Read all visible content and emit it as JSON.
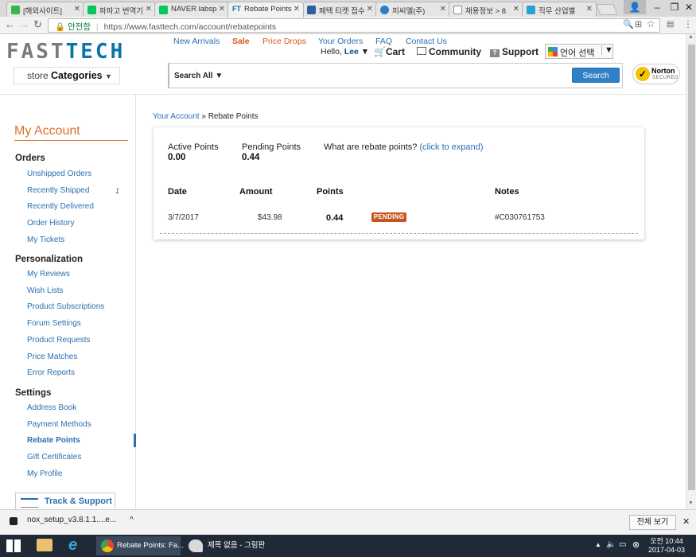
{
  "browser": {
    "tabs": [
      {
        "label": "[해외사이트]",
        "color": "#3bb54a"
      },
      {
        "label": "파파고 번역기",
        "color": "#03c75a"
      },
      {
        "label": "NAVER labsp",
        "color": "#03c75a"
      },
      {
        "label": "Rebate Points",
        "color": "#0b74a8"
      },
      {
        "label": "페텍 티켓 접수",
        "color": "#2f5d9e"
      },
      {
        "label": "피씨엘(주)",
        "color": "#2a7fc6"
      },
      {
        "label": "채용정보 > 8",
        "color": "#888888"
      },
      {
        "label": "직무 산업별",
        "color": "#2a9fd6"
      }
    ],
    "secure_label": "안전함",
    "url": "https://www.fasttech.com/account/rebatepoints"
  },
  "header": {
    "logo_part1": "FAST",
    "logo_part2": "TECH",
    "top_links": [
      "New Arrivals",
      "Sale",
      "Price Drops",
      "Your Orders",
      "FAQ",
      "Contact Us"
    ],
    "hello_prefix": "Hello,",
    "hello_name": "Lee",
    "cart": "Cart",
    "community": "Community",
    "support": "Support",
    "language": "언어 선택",
    "store_prefix": "store",
    "categories": "Categories",
    "search_scope": "Search All",
    "search_button": "Search",
    "norton_line1": "Norton",
    "norton_line2": "SECURED"
  },
  "sidebar": {
    "title": "My Account",
    "orders_title": "Orders",
    "orders": [
      "Unshipped Orders",
      "Recently Shipped",
      "Recently Delivered",
      "Order History",
      "My Tickets"
    ],
    "recently_shipped_count": "1",
    "personalization_title": "Personalization",
    "personalization": [
      "My Reviews",
      "Wish Lists",
      "Product Subscriptions",
      "Forum Settings",
      "Product Requests",
      "Price Matches",
      "Error Reports"
    ],
    "settings_title": "Settings",
    "settings": [
      "Address Book",
      "Payment Methods",
      "Rebate Points",
      "Gift Certificates",
      "My Profile"
    ],
    "track_support": "Track & Support"
  },
  "main": {
    "breadcrumb_link": "Your Account",
    "breadcrumb_sep": "»",
    "breadcrumb_current": "Rebate Points",
    "active_points_label": "Active Points",
    "active_points_value": "0.00",
    "pending_points_label": "Pending Points",
    "pending_points_value": "0.44",
    "what_are": "What are rebate points?",
    "expand_link": "(click to expand)",
    "columns": {
      "date": "Date",
      "amount": "Amount",
      "points": "Points",
      "notes": "Notes"
    },
    "rows": [
      {
        "date": "3/7/2017",
        "amount": "$43.98",
        "points": "0.44",
        "status": "PENDING",
        "notes": "#C030761753"
      }
    ]
  },
  "downloads": {
    "file": "nox_setup_v3.8.1.1....e...",
    "show_all": "전체 보기"
  },
  "taskbar": {
    "chrome_task": "Rebate Points: Fa...",
    "paint_task": "제목 없음 - 그림판",
    "time": "오전 10:44",
    "date": "2017-04-03"
  }
}
